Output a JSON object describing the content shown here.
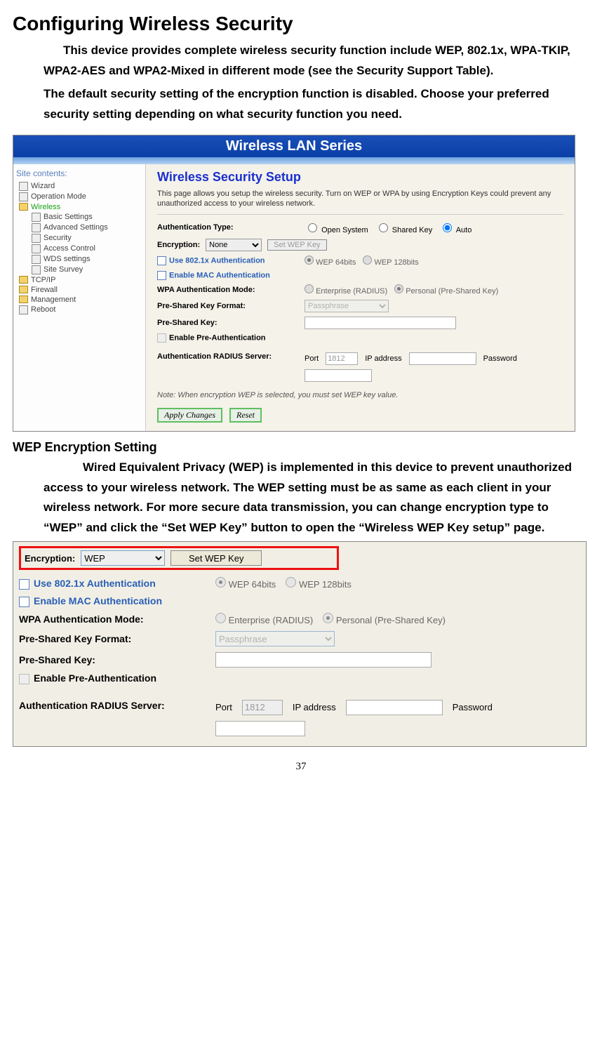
{
  "page_title": "Configuring Wireless Security",
  "intro_p1": "This device provides complete wireless security function include WEP, 802.1x, WPA-TKIP, WPA2-AES and WPA2-Mixed in different mode (see the Security Support Table).",
  "intro_p2": "The default security setting of the encryption function is disabled. Choose your preferred security setting depending on what security function you need.",
  "shot1": {
    "banner": "Wireless LAN Series",
    "side_header": "Site contents:",
    "tree": {
      "wizard": "Wizard",
      "opmode": "Operation Mode",
      "wireless": "Wireless",
      "basic": "Basic Settings",
      "advanced": "Advanced Settings",
      "security": "Security",
      "access": "Access Control",
      "wds": "WDS settings",
      "survey": "Site Survey",
      "tcpip": "TCP/IP",
      "firewall": "Firewall",
      "management": "Management",
      "reboot": "Reboot"
    },
    "heading": "Wireless Security Setup",
    "description": "This page allows you setup the wireless security. Turn on WEP or WPA by using Encryption Keys could prevent any unauthorized access to your wireless network.",
    "auth_type_label": "Authentication Type:",
    "auth_open": "Open System",
    "auth_shared": "Shared Key",
    "auth_auto": "Auto",
    "encryption_label": "Encryption:",
    "encryption_value": "None",
    "set_wep_key_btn": "Set WEP Key",
    "use8021x_label": "Use 802.1x Authentication",
    "wep64": "WEP 64bits",
    "wep128": "WEP 128bits",
    "enable_mac": "Enable MAC Authentication",
    "wpa_mode_label": "WPA Authentication Mode:",
    "wpa_enterprise": "Enterprise (RADIUS)",
    "wpa_personal": "Personal (Pre-Shared Key)",
    "psk_format_label": "Pre-Shared Key Format:",
    "psk_format_value": "Passphrase",
    "psk_label": "Pre-Shared Key:",
    "enable_preauth": "Enable Pre-Authentication",
    "radius_label": "Authentication RADIUS Server:",
    "port_label": "Port",
    "port_value": "1812",
    "ip_label": "IP address",
    "pw_label": "Password",
    "note": "Note: When encryption WEP is selected, you must set WEP key value.",
    "apply_btn": "Apply Changes",
    "reset_btn": "Reset"
  },
  "wep_heading": "WEP Encryption Setting",
  "wep_paragraph": "Wired Equivalent Privacy (WEP) is implemented in this device to prevent unauthorized access to your wireless network. The WEP setting must be as same as each client in your wireless network. For more secure data transmission, you can change encryption type to “WEP” and click the “Set WEP Key” button to open the “Wireless WEP Key setup” page.",
  "shot2": {
    "encryption_label": "Encryption:",
    "encryption_value": "WEP",
    "set_wep_key_btn": "Set WEP Key",
    "use8021x_label": "Use 802.1x Authentication",
    "wep64": "WEP 64bits",
    "wep128": "WEP 128bits",
    "enable_mac": "Enable MAC Authentication",
    "wpa_mode_label": "WPA Authentication Mode:",
    "wpa_enterprise": "Enterprise (RADIUS)",
    "wpa_personal": "Personal (Pre-Shared Key)",
    "psk_format_label": "Pre-Shared Key Format:",
    "psk_format_value": "Passphrase",
    "psk_label": "Pre-Shared Key:",
    "enable_preauth": "Enable Pre-Authentication",
    "radius_label": "Authentication RADIUS Server:",
    "port_label": "Port",
    "port_value": "1812",
    "ip_label": "IP address",
    "pw_label": "Password"
  },
  "page_number": "37"
}
